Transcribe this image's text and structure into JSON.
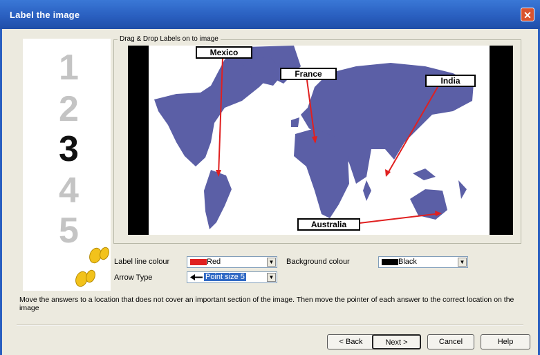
{
  "window": {
    "title": "Label the image",
    "close_label": "✕"
  },
  "steps": [
    "1",
    "2",
    "3",
    "4",
    "5"
  ],
  "active_step": "3",
  "map_group": {
    "title": "Drag & Drop Labels on to image"
  },
  "labels": [
    {
      "text": "Mexico"
    },
    {
      "text": "France"
    },
    {
      "text": "India"
    },
    {
      "text": "Australia"
    }
  ],
  "form": {
    "label_line_colour_label": "Label line colour",
    "label_line_colour_value": "Red",
    "label_line_colour_swatch": "#e02020",
    "background_colour_label": "Background colour",
    "background_colour_value": "Black",
    "background_colour_swatch": "#000000",
    "arrow_type_label": "Arrow Type",
    "arrow_type_value": "Point size 5"
  },
  "instructions": "Move the answers to a location that does not cover an important section of the image. Then move the pointer of each answer to the correct location on the image",
  "buttons": {
    "back": "< Back",
    "next": "Next >",
    "cancel": "Cancel",
    "help": "Help"
  },
  "colors": {
    "title_bar": "#2a5fc0",
    "map_land": "#5b5fa6",
    "label_line": "#e02020"
  }
}
